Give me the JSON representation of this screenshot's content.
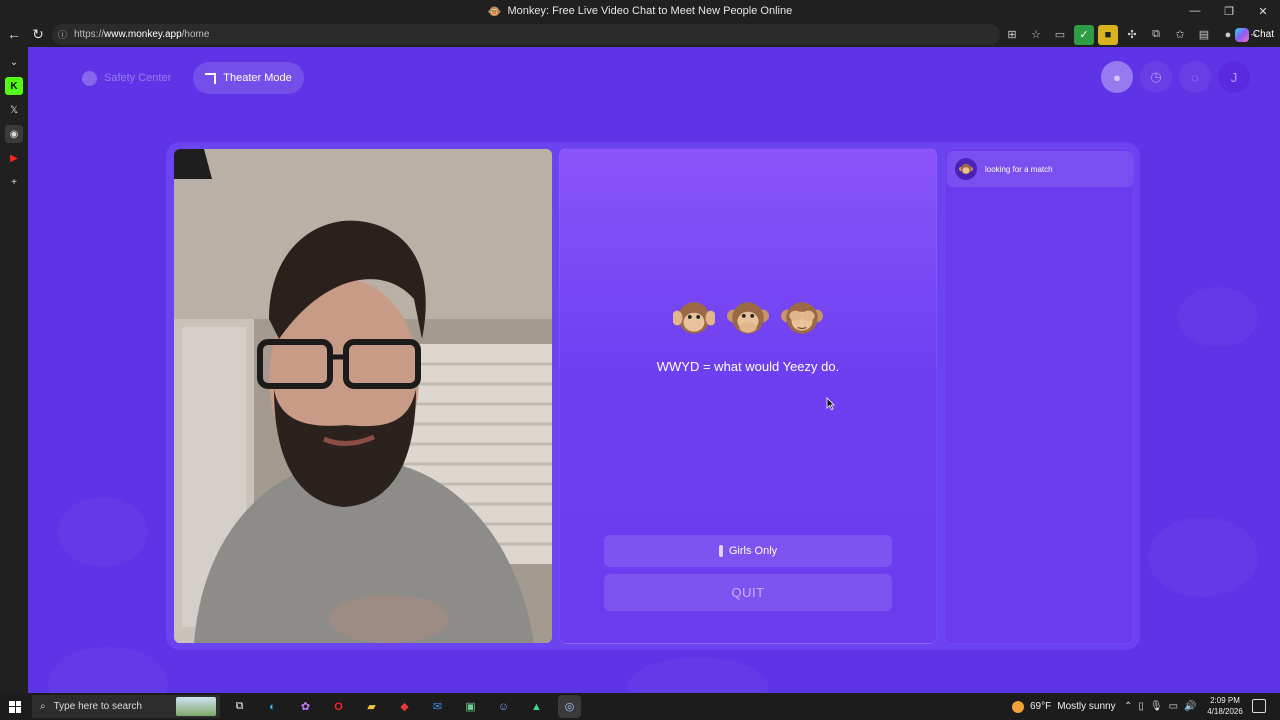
{
  "window": {
    "title": "Monkey: Free Live Video Chat to Meet New People Online",
    "controls": [
      "—",
      "❐",
      "✕"
    ]
  },
  "browser": {
    "url_scheme": "https://",
    "url_host": "www.monkey.app",
    "url_path": "/home",
    "chat_label": "Chat"
  },
  "app": {
    "safety_center_label": "Safety Center",
    "theater_mode_label": "Theater Mode",
    "avatar_initial": "J",
    "tagline": "WWYD = what would Yeezy do.",
    "girls_only_label": "Girls Only",
    "quit_label": "QUIT",
    "match_status": "looking for a match",
    "accent_color": "#5f33e6"
  },
  "taskbar": {
    "search_placeholder": "Type here to search",
    "weather_temp": "69°F",
    "weather_desc": "Mostly sunny",
    "time": "2:09 PM",
    "date": "4/18/2026"
  }
}
